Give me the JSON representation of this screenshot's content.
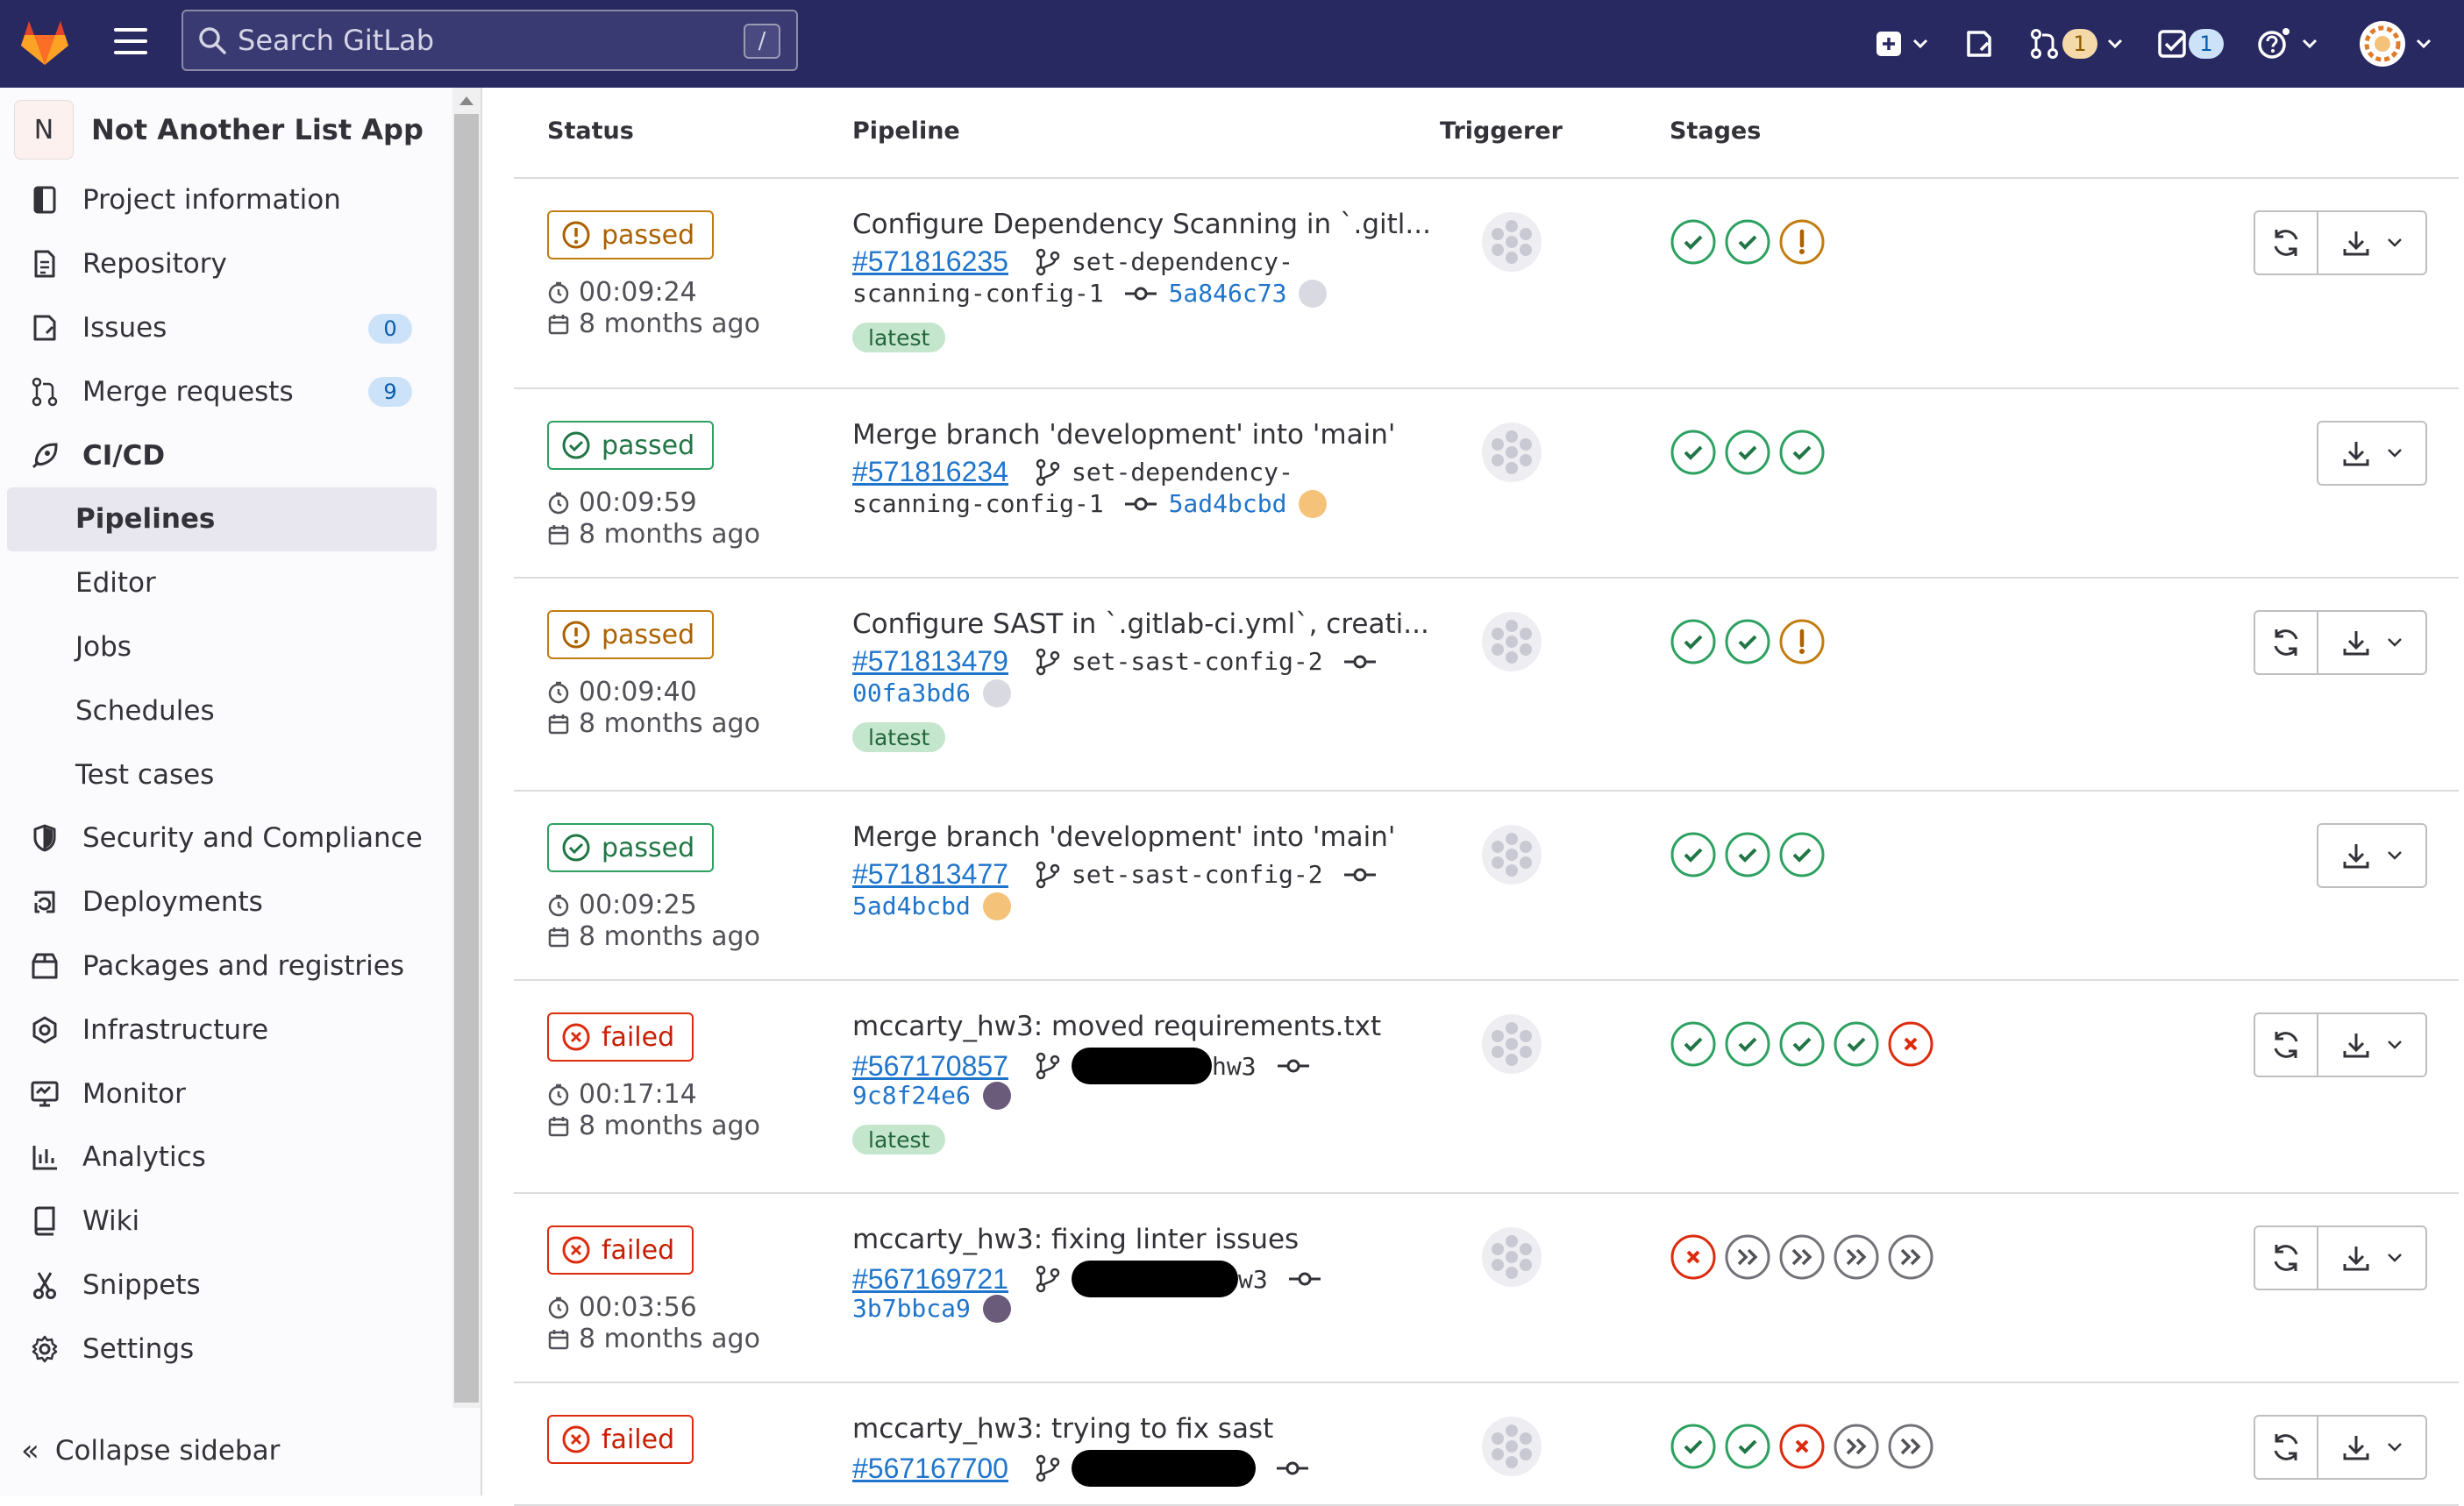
{
  "topbar": {
    "search_placeholder": "Search GitLab",
    "search_shortcut": "/",
    "mr_count": "1",
    "todo_count": "1"
  },
  "sidebar": {
    "project_initial": "N",
    "project_name": "Not Another List App",
    "items": [
      {
        "label": "Project information",
        "icon": "info-icon"
      },
      {
        "label": "Repository",
        "icon": "doc-icon"
      },
      {
        "label": "Issues",
        "icon": "issues-icon",
        "count": "0"
      },
      {
        "label": "Merge requests",
        "icon": "merge-request-icon",
        "count": "9"
      },
      {
        "label": "CI/CD",
        "icon": "rocket-icon"
      },
      {
        "label": "Pipelines"
      },
      {
        "label": "Editor"
      },
      {
        "label": "Jobs"
      },
      {
        "label": "Schedules"
      },
      {
        "label": "Test cases"
      },
      {
        "label": "Security and Compliance",
        "icon": "shield-icon"
      },
      {
        "label": "Deployments",
        "icon": "deployments-icon"
      },
      {
        "label": "Packages and registries",
        "icon": "package-icon"
      },
      {
        "label": "Infrastructure",
        "icon": "cloud-gear-icon"
      },
      {
        "label": "Monitor",
        "icon": "monitor-icon"
      },
      {
        "label": "Analytics",
        "icon": "chart-icon"
      },
      {
        "label": "Wiki",
        "icon": "book-icon"
      },
      {
        "label": "Snippets",
        "icon": "scissors-icon"
      },
      {
        "label": "Settings",
        "icon": "settings-icon"
      }
    ],
    "collapse_label": "Collapse sidebar"
  },
  "table": {
    "headers": {
      "status": "Status",
      "pipeline": "Pipeline",
      "triggerer": "Triggerer",
      "stages": "Stages"
    },
    "rows": [
      {
        "status": "passed",
        "status_kind": "warning",
        "duration": "00:09:24",
        "finished": "8 months ago",
        "title": "Configure Dependency Scanning in `.gitl...",
        "id": "#571816235",
        "branch_1": "set-dependency-",
        "branch_2": "scanning-config-1",
        "sha": "5a846c73",
        "latest": "latest",
        "stages": [
          "success",
          "success",
          "warning"
        ],
        "retry": true
      },
      {
        "status": "passed",
        "status_kind": "success",
        "duration": "00:09:59",
        "finished": "8 months ago",
        "title": "Merge branch 'development' into 'main'",
        "id": "#571816234",
        "branch_1": "set-dependency-",
        "branch_2": "scanning-config-1",
        "sha": "5ad4bcbd",
        "latest": "",
        "stages": [
          "success",
          "success",
          "success"
        ],
        "retry": false
      },
      {
        "status": "passed",
        "status_kind": "warning",
        "duration": "00:09:40",
        "finished": "8 months ago",
        "title": "Configure SAST in `.gitlab-ci.yml`, creati...",
        "id": "#571813479",
        "branch_1": "set-sast-config-2",
        "branch_2": "",
        "sha": "00fa3bd6",
        "latest": "latest",
        "stages": [
          "success",
          "success",
          "warning"
        ],
        "retry": true
      },
      {
        "status": "passed",
        "status_kind": "success",
        "duration": "00:09:25",
        "finished": "8 months ago",
        "title": "Merge branch 'development' into 'main'",
        "id": "#571813477",
        "branch_1": "set-sast-config-2",
        "branch_2": "",
        "sha": "5ad4bcbd",
        "latest": "",
        "stages": [
          "success",
          "success",
          "success"
        ],
        "retry": false
      },
      {
        "status": "failed",
        "status_kind": "failed",
        "duration": "00:17:14",
        "finished": "8 months ago",
        "title": "mccarty_hw3: moved requirements.txt",
        "id": "#567170857",
        "branch_1": "hw3",
        "branch_2": "",
        "sha": "9c8f24e6",
        "latest": "latest",
        "stages": [
          "success",
          "success",
          "success",
          "success",
          "failed"
        ],
        "retry": true
      },
      {
        "status": "failed",
        "status_kind": "failed",
        "duration": "00:03:56",
        "finished": "8 months ago",
        "title": "mccarty_hw3: fixing linter issues",
        "id": "#567169721",
        "branch_1": "w3",
        "branch_2": "",
        "sha": "3b7bbca9",
        "latest": "",
        "stages": [
          "failed",
          "skipped",
          "skipped",
          "skipped",
          "skipped"
        ],
        "retry": true
      },
      {
        "status": "failed",
        "status_kind": "failed",
        "duration": "",
        "finished": "",
        "title": "mccarty_hw3: trying to fix sast",
        "id": "#567167700",
        "branch_1": "",
        "branch_2": "",
        "sha": "",
        "latest": "",
        "stages": [
          "success",
          "success",
          "failed",
          "skipped",
          "skipped"
        ],
        "retry": true
      }
    ]
  },
  "colors": {
    "topbar": "#292961",
    "success": "#217645",
    "warning": "#ab6100",
    "failed": "#dd2b0e",
    "link": "#1f75cb"
  }
}
